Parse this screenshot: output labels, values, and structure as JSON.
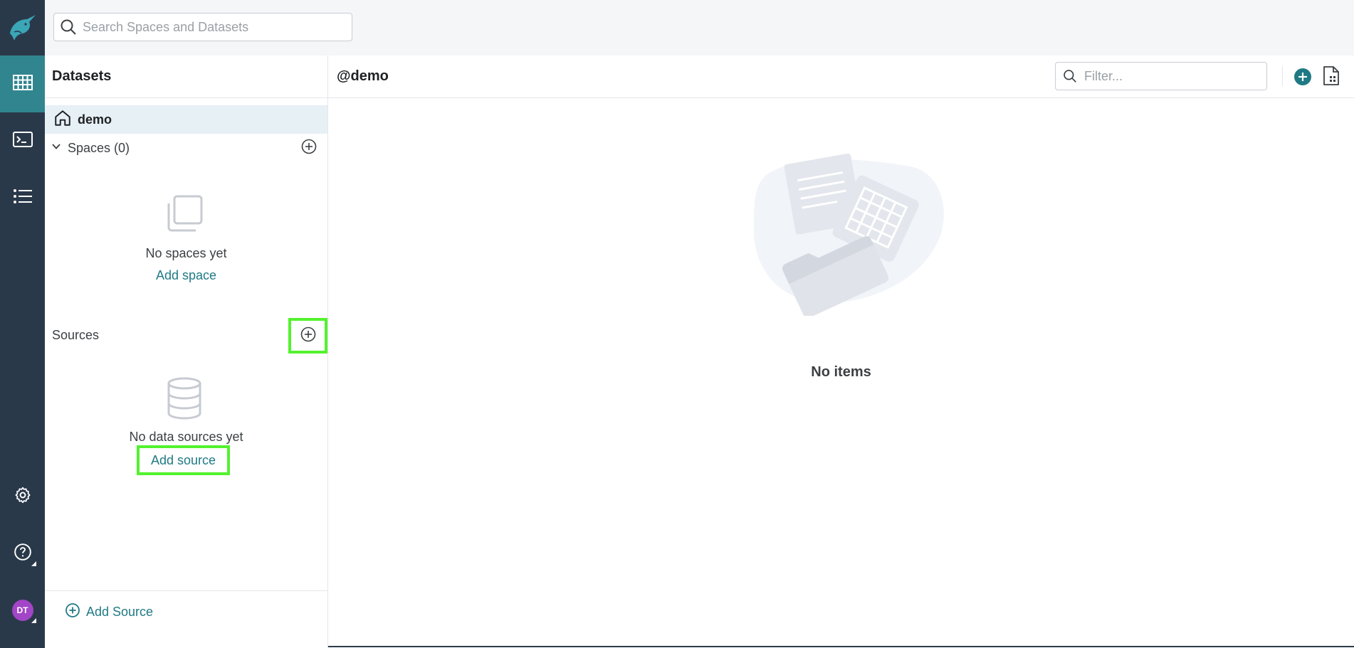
{
  "topbar": {
    "search_placeholder": "Search Spaces and Datasets"
  },
  "rail": {
    "avatar_initials": "DT",
    "nav": [
      {
        "icon": "grid-table-icon",
        "active": true
      },
      {
        "icon": "terminal-icon",
        "active": false
      },
      {
        "icon": "list-icon",
        "active": false
      }
    ],
    "utils": [
      {
        "icon": "gear-icon"
      },
      {
        "icon": "help-circle-icon"
      }
    ]
  },
  "panel": {
    "title": "Datasets",
    "home_label": "demo",
    "spaces_label": "Spaces (0)",
    "empty_spaces_text": "No spaces yet",
    "add_space_link": "Add space",
    "sources_label": "Sources",
    "empty_sources_text": "No data sources yet",
    "add_source_link": "Add source",
    "footer_add_source": "Add Source"
  },
  "main": {
    "title": "@demo",
    "filter_placeholder": "Filter...",
    "empty_text": "No items"
  },
  "colors": {
    "rail_bg": "#2a394a",
    "accent": "#31858f",
    "link": "#207a85",
    "highlight_box": "#53f22e",
    "avatar_bg": "#a245c7"
  }
}
